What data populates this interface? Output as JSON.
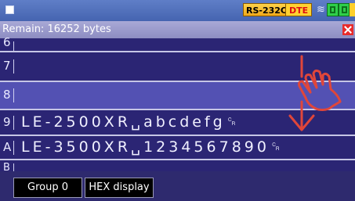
{
  "status": {
    "interface_label": "RS-232C",
    "dte_label": "DTE",
    "icons": [
      "menu-square-icon",
      "signal-wave-icon",
      "green-port-icon",
      "green-memory-icon",
      "battery-bolt-icon"
    ]
  },
  "info": {
    "remain_text": "Remain: 16252 bytes"
  },
  "rows": [
    {
      "num": "6",
      "text": ""
    },
    {
      "num": "7",
      "text": ""
    },
    {
      "num": "8",
      "text": ""
    },
    {
      "num": "9",
      "text": "LE-2500XR␣abcdefg␍"
    },
    {
      "num": "A",
      "text": "LE-3500XR␣1234567890␍"
    },
    {
      "num": "B",
      "text": ""
    }
  ],
  "selected_row": "8",
  "buttons": {
    "group": "Group 0",
    "hex": "HEX display"
  },
  "colors": {
    "status_bar": "#4f6ebb",
    "info_bar": "#9a9acb",
    "row_bg": "#2b2574",
    "row_selected": "#5351b3",
    "gesture": "#e0463a"
  }
}
